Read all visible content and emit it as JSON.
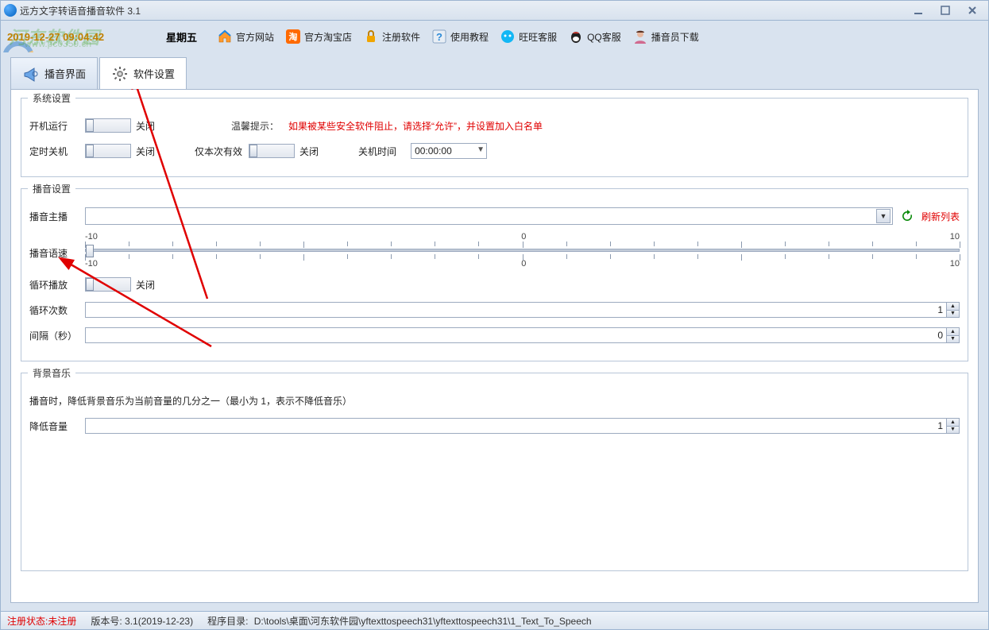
{
  "title": "远方文字转语音播音软件 3.1",
  "date": {
    "line": "2019-12-27 09:04:42",
    "day": "星期五"
  },
  "watermark": {
    "name": "河东软件园",
    "url": "www.pc0359.cn"
  },
  "toolbar_links": [
    {
      "label": "官方网站",
      "icon": "home-icon",
      "color": "#1e88e5"
    },
    {
      "label": "官方淘宝店",
      "icon": "taobao-icon",
      "color": "#ff6a00"
    },
    {
      "label": "注册软件",
      "icon": "lock-icon",
      "color": "#f0a500"
    },
    {
      "label": "使用教程",
      "icon": "help-icon",
      "color": "#2e8bd8"
    },
    {
      "label": "旺旺客服",
      "icon": "wangwang-icon",
      "color": "#12b7f5"
    },
    {
      "label": "QQ客服",
      "icon": "qq-icon",
      "color": "#ef3b2f"
    },
    {
      "label": "播音员下载",
      "icon": "person-icon",
      "color": "#d16a8f"
    }
  ],
  "tabs": [
    {
      "label": "播音界面",
      "icon": "megaphone-icon",
      "active": false
    },
    {
      "label": "软件设置",
      "icon": "gear-icon",
      "active": true
    }
  ],
  "groups": {
    "system": {
      "title": "系统设置",
      "autorun_label": "开机运行",
      "autorun_state": "关闭",
      "hint_label": "温馨提示：",
      "hint_text": "如果被某些安全软件阻止，请选择“允许”，并设置加入白名单",
      "shutdown_label": "定时关机",
      "shutdown_state": "关闭",
      "once_label": "仅本次有效",
      "once_state": "关闭",
      "shutdown_time_label": "关机时间",
      "shutdown_time_value": "00:00:00"
    },
    "broadcast": {
      "title": "播音设置",
      "host_label": "播音主播",
      "refresh_label": "刷新列表",
      "speed_label": "播音语速",
      "speed_scale": {
        "min": "-10",
        "mid": "0",
        "max": "10"
      },
      "loop_label": "循环播放",
      "loop_state": "关闭",
      "loop_count_label": "循环次数",
      "loop_count_value": "1",
      "interval_label": "间隔（秒）",
      "interval_value": "0"
    },
    "bgm": {
      "title": "背景音乐",
      "desc": "播音时，降低背景音乐为当前音量的几分之一（最小为 1，表示不降低音乐）",
      "reduce_label": "降低音量",
      "reduce_value": "1"
    }
  },
  "status": {
    "reg_state_label": "注册状态:",
    "reg_state_value": "未注册",
    "version_label": "版本号:",
    "version_value": "3.1(2019-12-23)",
    "dir_label": "程序目录:",
    "dir_value": "D:\\tools\\桌面\\河东软件园\\yftexttospeech31\\yftexttospeech31\\1_Text_To_Speech"
  }
}
